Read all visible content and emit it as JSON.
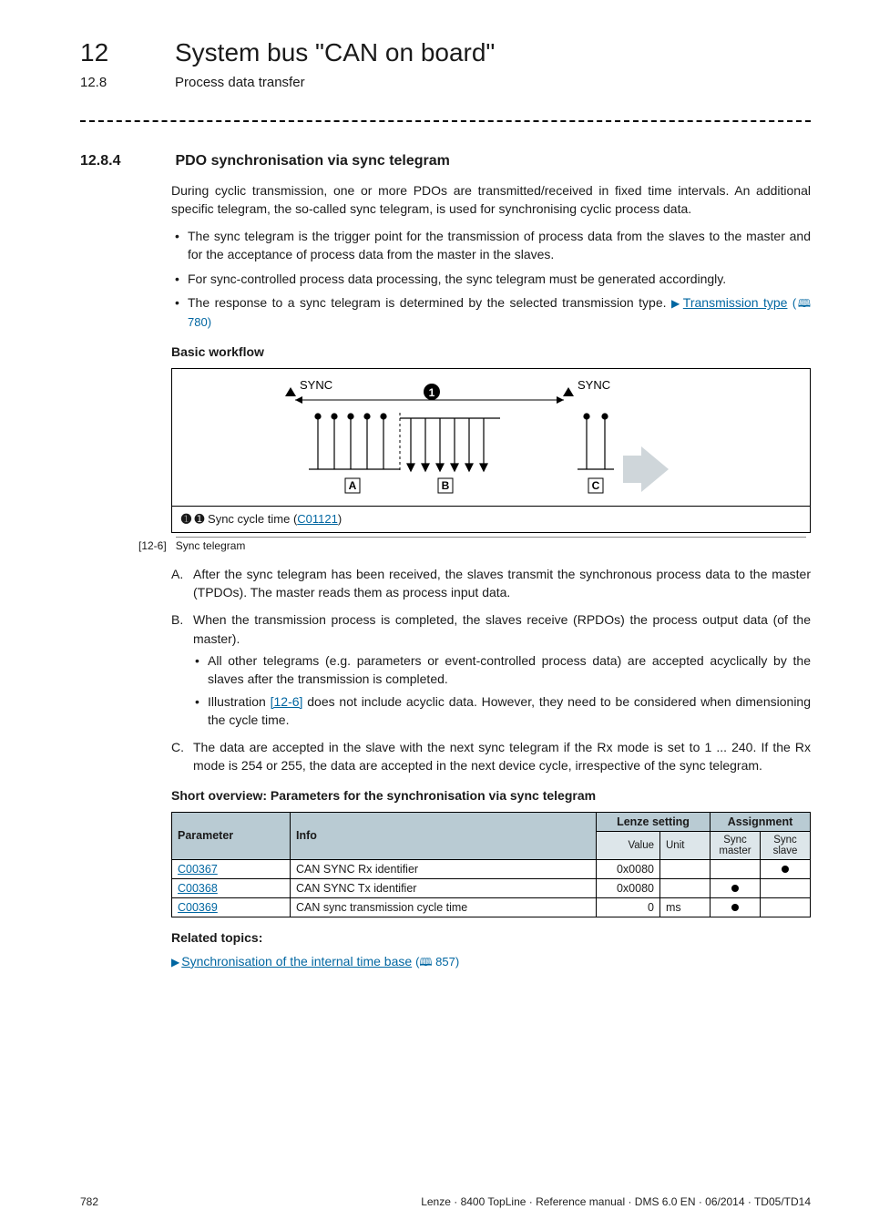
{
  "header": {
    "chapter_num": "12",
    "chapter_title": "System bus \"CAN on board\"",
    "section_num": "12.8",
    "section_title": "Process data transfer"
  },
  "subsection": {
    "num": "12.8.4",
    "title": "PDO synchronisation via sync telegram"
  },
  "intro_para": "During cyclic transmission, one or more PDOs are transmitted/received in fixed time intervals. An additional specific telegram, the so-called sync telegram, is used for synchronising cyclic process data.",
  "intro_bullets": {
    "b1": "The sync telegram is the trigger point for the transmission of process data from the slaves to the master and for the acceptance of process data from the master in the slaves.",
    "b2": "For sync-controlled process data processing, the sync telegram must be generated accordingly.",
    "b3_pre": "The response to a sync telegram is determined by the selected transmission type. ",
    "b3_link": "Transmission type",
    "b3_ref": " 780)"
  },
  "basic_workflow_heading": "Basic workflow",
  "diagram": {
    "sync_label": "SYNC",
    "bubble": "➊",
    "boxA": "A",
    "boxB": "B",
    "boxC": "C",
    "caption_prefix": "➊ Sync cycle time (",
    "caption_link": "C01121",
    "caption_suffix": ")",
    "figref": "[12-6]",
    "figtitle": "Sync telegram"
  },
  "lettered": {
    "A": "After the sync telegram has been received, the slaves transmit the synchronous process data to the master (TPDOs). The master reads them as process input data.",
    "B_main": "When the transmission process is completed, the slaves receive (RPDOs) the process output data (of the master).",
    "B_sub1": "All other telegrams (e.g. parameters or event-controlled process data) are accepted acyclically by the slaves after the transmission is completed.",
    "B_sub2_pre": "Illustration ",
    "B_sub2_link": "[12-6]",
    "B_sub2_post": " does not include acyclic data. However, they need to be considered when dimensioning the cycle time.",
    "C": "The data are accepted in the slave with the next sync telegram if the Rx mode is set to 1 ... 240. If the Rx mode is 254 or 255, the data are accepted in the next device cycle, irrespective of the sync telegram."
  },
  "overview_heading": "Short overview: Parameters for the synchronisation via sync telegram",
  "table": {
    "head": {
      "param": "Parameter",
      "info": "Info",
      "lenze": "Lenze setting",
      "assign": "Assignment",
      "value": "Value",
      "unit": "Unit",
      "sync_master": "Sync master",
      "sync_slave": "Sync slave"
    },
    "rows": [
      {
        "param": "C00367",
        "info": "CAN SYNC Rx identifier",
        "value": "0x0080",
        "unit": "",
        "master": false,
        "slave": true
      },
      {
        "param": "C00368",
        "info": "CAN SYNC Tx identifier",
        "value": "0x0080",
        "unit": "",
        "master": true,
        "slave": false
      },
      {
        "param": "C00369",
        "info": "CAN sync transmission cycle time",
        "value": "0",
        "unit": "ms",
        "master": true,
        "slave": false
      }
    ]
  },
  "related": {
    "heading": "Related topics:",
    "link": "Synchronisation of the internal time base",
    "ref": " 857)"
  },
  "footer": {
    "page": "782",
    "right": "Lenze · 8400 TopLine · Reference manual · DMS 6.0 EN · 06/2014 · TD05/TD14"
  }
}
